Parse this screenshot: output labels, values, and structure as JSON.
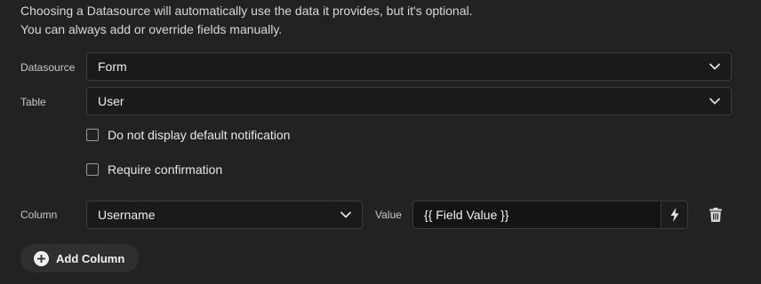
{
  "intro": {
    "line1": "Choosing a Datasource will automatically use the data it provides, but it's optional.",
    "line2": "You can always add or override fields manually."
  },
  "datasource": {
    "label": "Datasource",
    "value": "Form"
  },
  "table": {
    "label": "Table",
    "value": "User"
  },
  "checkboxes": {
    "no_notification": {
      "label": "Do not display default notification",
      "checked": false
    },
    "require_confirmation": {
      "label": "Require confirmation",
      "checked": false
    }
  },
  "column_row": {
    "column_label": "Column",
    "column_value": "Username",
    "value_label": "Value",
    "value_text": "{{ Field Value }}",
    "bolt_icon": "lightning-icon",
    "delete_icon": "trash-icon"
  },
  "add_column": {
    "label": "Add Column",
    "icon": "plus-circle-icon"
  },
  "colors": {
    "background": "#222222",
    "field_background": "#1a1a1a",
    "field_border": "#3b3b3b",
    "button_background": "#2f2f2f"
  }
}
